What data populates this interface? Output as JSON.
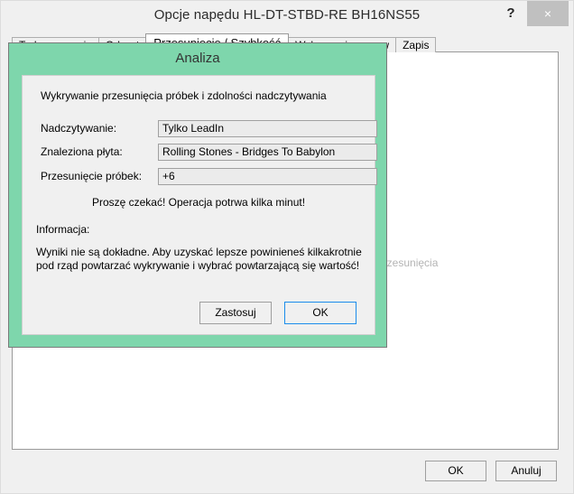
{
  "window": {
    "title": "Opcje napędu HL-DT-STBD-RE  BH16NS55",
    "help_icon": "?",
    "close_icon": "×"
  },
  "tabs": [
    {
      "label": "Tryb zgrywania",
      "active": false
    },
    {
      "label": "Odczyt",
      "active": false
    },
    {
      "label": "Przesunięcie / Szybkość",
      "active": true
    },
    {
      "label": "Wykrywanie przerw",
      "active": false
    },
    {
      "label": "Zapis",
      "active": false
    }
  ],
  "background_panel": {
    "faded_label": "przesunięcia"
  },
  "main_buttons": {
    "ok": "OK",
    "cancel": "Anuluj"
  },
  "dialog": {
    "title": "Analiza",
    "intro": "Wykrywanie przesunięcia próbek i zdolności nadczytywania",
    "fields": [
      {
        "label": "Nadczytywanie:",
        "value": "Tylko LeadIn"
      },
      {
        "label": "Znaleziona płyta:",
        "value": "Rolling Stones - Bridges To Babylon"
      },
      {
        "label": "Przesunięcie próbek:",
        "value": "+6"
      }
    ],
    "wait_message": "Proszę czekać! Operacja potrwa kilka minut!",
    "info_heading": "Informacja:",
    "info_body": "Wyniki nie są dokładne. Aby uzyskać lepsze powinieneś kilkakrotnie pod rząd powtarzać wykrywanie i wybrać powtarzającą się wartość!",
    "buttons": {
      "apply": "Zastosuj",
      "ok": "OK"
    }
  },
  "colors": {
    "dialog_green": "#7ed6ac",
    "focus_blue": "#1b8ceb",
    "window_bg": "#f0f0f0",
    "panel_white": "#ffffff",
    "faded_text": "#b4b4b4"
  }
}
